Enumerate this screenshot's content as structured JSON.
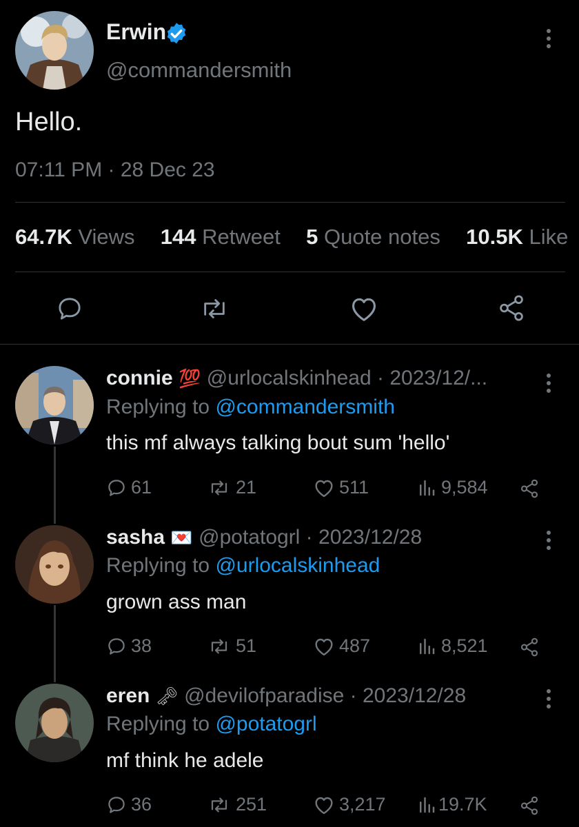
{
  "tweet": {
    "author_name": "Erwin",
    "author_handle": "@commandersmith",
    "text": "Hello.",
    "timestamp": "07:11 PM · 28 Dec 23",
    "stats": {
      "views_num": "64.7K",
      "views_label": "Views",
      "retweet_num": "144",
      "retweet_label": "Retweet",
      "quote_num": "5",
      "quote_label": "Quote notes",
      "like_num": "10.5K",
      "like_label": "Like"
    }
  },
  "replies": [
    {
      "name": "connie",
      "emoji": "💯",
      "handle_date": "@urlocalskinhead · 2023/12/...",
      "replying_prefix": "Replying to",
      "replying_to": "@commandersmith",
      "text": "this mf always talking bout sum 'hello'",
      "replies": "61",
      "retweets": "21",
      "likes": "511",
      "views": "9,584"
    },
    {
      "name": "sasha",
      "emoji": "💌",
      "handle_date": "@potatogrl · 2023/12/28",
      "replying_prefix": "Replying to",
      "replying_to": "@urlocalskinhead",
      "text": "grown ass man",
      "replies": "38",
      "retweets": "51",
      "likes": "487",
      "views": "8,521"
    },
    {
      "name": "eren",
      "emoji": "🗝",
      "handle_date": "@devilofparadise · 2023/12/28",
      "replying_prefix": "Replying to",
      "replying_to": "@potatogrl",
      "text": "mf think he adele",
      "replies": "36",
      "retweets": "251",
      "likes": "3,217",
      "views": "19.7K"
    }
  ],
  "colors": {
    "background": "#000000",
    "text": "#e7e9ea",
    "muted": "#71767b",
    "link": "#1d9bf0",
    "verified": "#1d9bf0"
  }
}
